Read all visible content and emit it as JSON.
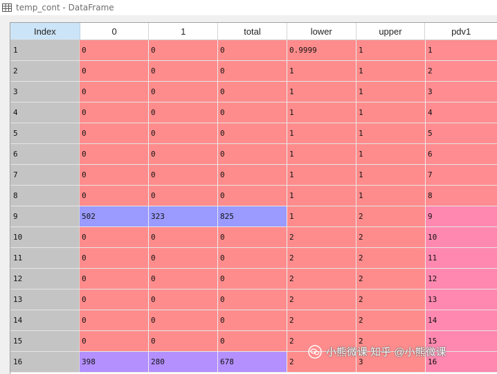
{
  "window": {
    "title": "temp_cont - DataFrame",
    "icon": "table-icon"
  },
  "table": {
    "columns": [
      "Index",
      "0",
      "1",
      "total",
      "lower",
      "upper",
      "pdv1"
    ],
    "rows": [
      [
        "1",
        "0",
        "0",
        "0",
        "0.9999",
        "1",
        "1"
      ],
      [
        "2",
        "0",
        "0",
        "0",
        "1",
        "1",
        "2"
      ],
      [
        "3",
        "0",
        "0",
        "0",
        "1",
        "1",
        "3"
      ],
      [
        "4",
        "0",
        "0",
        "0",
        "1",
        "1",
        "4"
      ],
      [
        "5",
        "0",
        "0",
        "0",
        "1",
        "1",
        "5"
      ],
      [
        "6",
        "0",
        "0",
        "0",
        "1",
        "1",
        "6"
      ],
      [
        "7",
        "0",
        "0",
        "0",
        "1",
        "1",
        "7"
      ],
      [
        "8",
        "0",
        "0",
        "0",
        "1",
        "1",
        "8"
      ],
      [
        "9",
        "502",
        "323",
        "825",
        "1",
        "2",
        "9"
      ],
      [
        "10",
        "0",
        "0",
        "0",
        "2",
        "2",
        "10"
      ],
      [
        "11",
        "0",
        "0",
        "0",
        "2",
        "2",
        "11"
      ],
      [
        "12",
        "0",
        "0",
        "0",
        "2",
        "2",
        "12"
      ],
      [
        "13",
        "0",
        "0",
        "0",
        "2",
        "2",
        "13"
      ],
      [
        "14",
        "0",
        "0",
        "0",
        "2",
        "2",
        "14"
      ],
      [
        "15",
        "0",
        "0",
        "0",
        "2",
        "2",
        "15"
      ],
      [
        "16",
        "398",
        "280",
        "678",
        "2",
        "3",
        "16"
      ]
    ],
    "colors": {
      "low": "#ff8c8c",
      "high_9": "#9a9aff",
      "high_16": "#b490ff",
      "pdv_low": "#ff8c90",
      "pdv_high": "#ff88b0",
      "index_bg": "#c4c4c4",
      "index_header_bg": "#cce4f7"
    }
  },
  "watermark": {
    "text": "小熊微课 知乎 @小熊微课",
    "icon": "wechat-icon"
  }
}
